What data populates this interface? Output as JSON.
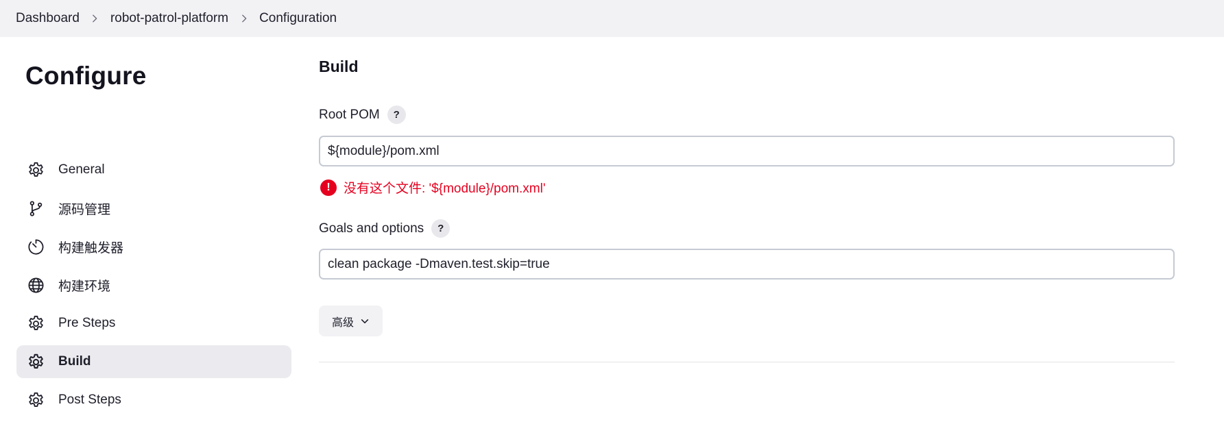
{
  "breadcrumb": {
    "items": [
      "Dashboard",
      "robot-patrol-platform",
      "Configuration"
    ]
  },
  "sidebar": {
    "title": "Configure",
    "items": [
      {
        "label": "General",
        "icon": "gear-icon"
      },
      {
        "label": "源码管理",
        "icon": "branch-icon"
      },
      {
        "label": "构建触发器",
        "icon": "timer-icon"
      },
      {
        "label": "构建环境",
        "icon": "globe-icon"
      },
      {
        "label": "Pre Steps",
        "icon": "gear-icon"
      },
      {
        "label": "Build",
        "icon": "gear-icon",
        "active": true
      },
      {
        "label": "Post Steps",
        "icon": "gear-icon"
      }
    ]
  },
  "main": {
    "section_title": "Build",
    "root_pom": {
      "label": "Root POM",
      "help": "?",
      "value": "${module}/pom.xml",
      "error_icon": "!",
      "error": "没有这个文件: '${module}/pom.xml'"
    },
    "goals": {
      "label": "Goals and options",
      "help": "?",
      "value": "clean package -Dmaven.test.skip=true"
    },
    "advanced_label": "高级"
  },
  "colors": {
    "error": "#e6001f",
    "topbar_bg": "#f2f2f5",
    "active_bg": "#ebebef"
  }
}
